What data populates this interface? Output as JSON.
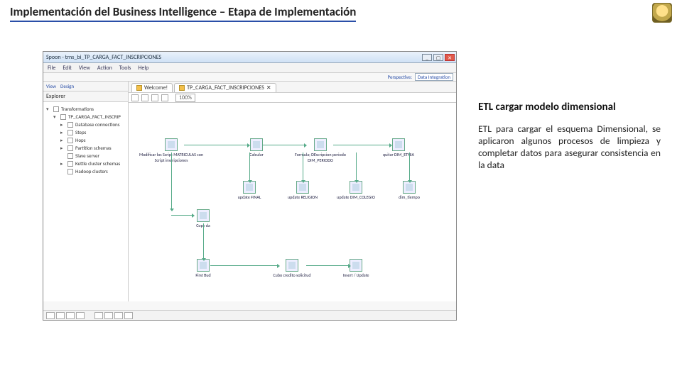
{
  "slide": {
    "title": "Implementación del Business Intelligence – Etapa de Implementación"
  },
  "window": {
    "title": "Spoon - trns_bi_TP_CARGA_FACT_INSCRIPCIONES",
    "menu": [
      "File",
      "Edit",
      "View",
      "Action",
      "Tools",
      "Help"
    ],
    "perspectives": {
      "label": "Perspective:",
      "active": "Data Integration"
    },
    "leftTabs": {
      "view": "View",
      "design": "Design"
    },
    "explorerLabel": "Explorer",
    "tree": {
      "root": "Transformations",
      "child": "TP_CARGA_FACT_INSCRIP",
      "leaves": [
        "Database connections",
        "Steps",
        "Hops",
        "Partition schemas",
        "Slave server",
        "Kettle cluster schemas",
        "Hadoop clusters"
      ]
    },
    "docTabs": {
      "welcome": "Welcome!",
      "trans": "TP_CARGA_FACT_INSCRIPCIONES"
    },
    "zoom": "100%",
    "nodes": {
      "n1": "Modificar los Script MATRICULAS con Script inscripciones",
      "n2": "Calcular",
      "n3": "Formula; DEscripcion periodo DIM_PERIODO",
      "n4": "quitar DIM_ETNIA",
      "n5": "update FINAL",
      "n6": "update RELIGION",
      "n7": "update DIM_COLEGIO",
      "n8": "dim_tiempo",
      "n9": "Copy da",
      "n10": "First Bud",
      "n11": "Cubo credito solicitud",
      "n12": "Insert / Update"
    }
  },
  "side": {
    "heading": "ETL cargar modelo dimensional",
    "body": "ETL para cargar el esquema Dimensional, se aplicaron algunos procesos de limpieza y completar datos para asegurar consistencia en la data"
  }
}
